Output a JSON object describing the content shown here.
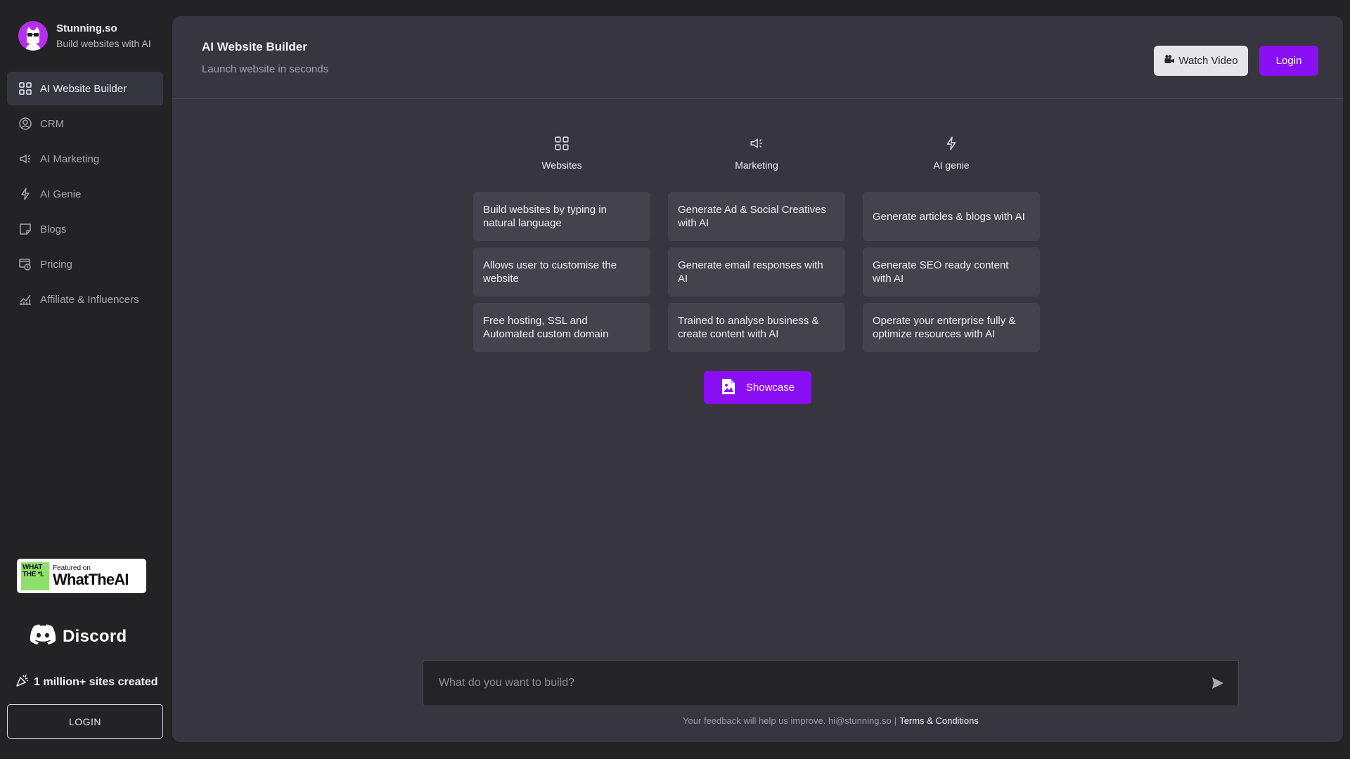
{
  "brand": {
    "name": "Stunning.so",
    "tagline": "Build websites with AI"
  },
  "sidebar": {
    "items": [
      {
        "label": "AI Website Builder",
        "icon": "grid-icon",
        "active": true
      },
      {
        "label": "CRM",
        "icon": "user-circle-icon"
      },
      {
        "label": "AI Marketing",
        "icon": "megaphone-icon"
      },
      {
        "label": "AI Genie",
        "icon": "lightning-icon"
      },
      {
        "label": "Blogs",
        "icon": "note-icon"
      },
      {
        "label": "Pricing",
        "icon": "pricing-icon"
      },
      {
        "label": "Affiliate & Influencers",
        "icon": "chart-line-icon"
      }
    ],
    "badge": {
      "mark": "WHAT THE *I.",
      "small": "Featured on",
      "big": "WhatTheAI"
    },
    "discord": "Discord",
    "sites_created": "1 million+ sites created",
    "login": "LOGIN"
  },
  "header": {
    "title": "AI Website Builder",
    "subtitle": "Launch website in seconds",
    "watch_video": "Watch Video",
    "login": "Login"
  },
  "columns": [
    {
      "title": "Websites",
      "icon": "grid-icon",
      "cards": [
        "Build websites by typing in natural language",
        "Allows user to customise the website",
        "Free hosting, SSL and Automated custom domain"
      ]
    },
    {
      "title": "Marketing",
      "icon": "megaphone-icon",
      "cards": [
        "Generate Ad & Social Creatives with AI",
        "Generate email responses with AI",
        "Trained to analyse business & create content with AI"
      ]
    },
    {
      "title": "AI genie",
      "icon": "lightning-icon",
      "cards": [
        "Generate articles & blogs with AI",
        "Generate SEO ready content with AI",
        "Operate your enterprise fully & optimize resources with AI"
      ]
    }
  ],
  "showcase": "Showcase",
  "prompt": {
    "placeholder": "What do you want to build?"
  },
  "footer": {
    "feedback": "Your feedback will help us improve. hi@stunning.so",
    "separator": "|",
    "terms": "Terms & Conditions"
  },
  "colors": {
    "accent": "#8b0ff5",
    "brand_logo": "#b62ff0",
    "panel": "#37363f",
    "card": "#44434d",
    "sidebar": "#232326"
  }
}
